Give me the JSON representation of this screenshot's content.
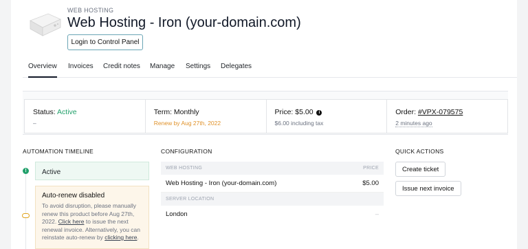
{
  "header": {
    "eyebrow": "WEB HOSTING",
    "title": "Web Hosting - Iron (your-domain.com)",
    "login_button": "Login to Control Panel",
    "product_icon": "server-box-icon"
  },
  "tabs": [
    {
      "label": "Overview",
      "active": true
    },
    {
      "label": "Invoices"
    },
    {
      "label": "Credit notes"
    },
    {
      "label": "Manage"
    },
    {
      "label": "Settings"
    },
    {
      "label": "Delegates"
    }
  ],
  "summary": {
    "status_label": "Status:",
    "status_value": "Active",
    "status_sub": "–",
    "term_label": "Term:",
    "term_value": "Monthly",
    "term_sub": "Renew by Aug 27th, 2022",
    "price_label": "Price:",
    "price_value": "$5.00",
    "price_sub": "$6.00 including tax",
    "order_label": "Order:",
    "order_value": "#VPX-079575",
    "order_sub": "2 minutes ago"
  },
  "timeline": {
    "heading": "AUTOMATION TIMELINE",
    "active_label": "Active",
    "warn_title": "Auto-renew disabled",
    "warn_text_1": "To avoid disruption, please manually renew this product before Aug 27th, 2022.",
    "warn_link_1": "Click here",
    "warn_text_2": "to issue the next renewal invoice. Alternatively, you can reinstate auto-renew by",
    "warn_link_2": "clicking here",
    "warn_text_3": "."
  },
  "configuration": {
    "heading": "CONFIGURATION",
    "group1_label": "WEB HOSTING",
    "price_col": "PRICE",
    "item_name": "Web Hosting - Iron (your-domain.com)",
    "item_price": "$5.00",
    "group2_label": "SERVER LOCATION",
    "location": "London",
    "location_price": "–"
  },
  "quick_actions": {
    "heading": "QUICK ACTIONS",
    "create_ticket": "Create ticket",
    "issue_invoice": "Issue next invoice"
  },
  "colors": {
    "active_green": "#22a06b",
    "renew_orange": "#e0922a",
    "login_border": "#6aa5b5"
  }
}
